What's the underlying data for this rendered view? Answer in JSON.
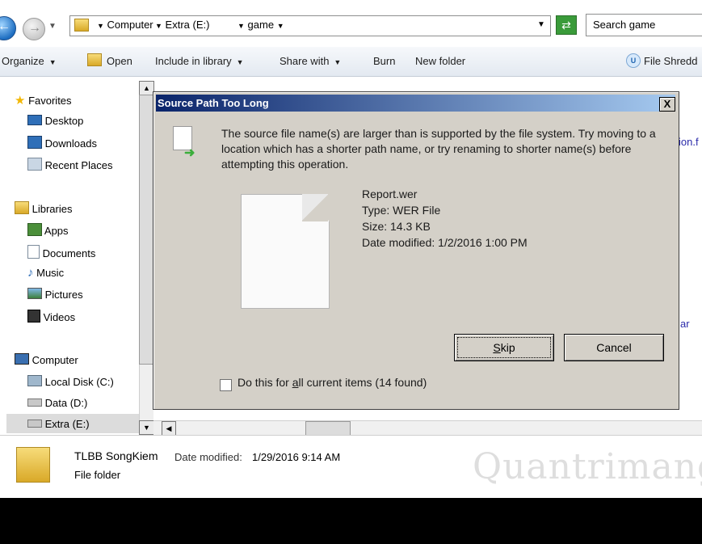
{
  "address": {
    "crumbs": [
      "Computer",
      "Extra (E:)",
      "game"
    ],
    "search_placeholder": "Search game"
  },
  "toolbar": {
    "organize": "Organize",
    "open": "Open",
    "include_in_library": "Include in library",
    "share_with": "Share with",
    "burn": "Burn",
    "new_folder": "New folder",
    "file_shredder": "File Shredd"
  },
  "nav": {
    "favorites": "Favorites",
    "desktop": "Desktop",
    "downloads": "Downloads",
    "recent_places": "Recent Places",
    "libraries": "Libraries",
    "apps": "Apps",
    "documents": "Documents",
    "music": "Music",
    "pictures": "Pictures",
    "videos": "Videos",
    "computer": "Computer",
    "local_disk": "Local Disk (C:)",
    "data_d": "Data (D:)",
    "extra_e": "Extra (E:)"
  },
  "content": {
    "fragment_1": "ion.f",
    "fragment_2": "ar"
  },
  "details": {
    "name": "TLBB SongKiem",
    "modified_label": "Date modified:",
    "modified_value": "1/29/2016 9:14 AM",
    "type": "File folder"
  },
  "watermark": "Quantrimang",
  "dialog": {
    "title": "Source Path Too Long",
    "close": "X",
    "message": "The source file name(s) are larger than is supported by the file system. Try moving to a location which has a shorter path name, or try renaming to shorter name(s) before attempting this operation.",
    "file_name": "Report.wer",
    "file_type": "Type: WER File",
    "file_size": "Size: 14.3 KB",
    "file_modified": "Date modified: 1/2/2016 1:00 PM",
    "skip_pre": "",
    "skip_key": "S",
    "skip_post": "kip",
    "cancel": "Cancel",
    "checkbox_pre": "Do this for ",
    "checkbox_key": "a",
    "checkbox_post": "ll current items (14 found)",
    "checkbox_checked": false
  }
}
